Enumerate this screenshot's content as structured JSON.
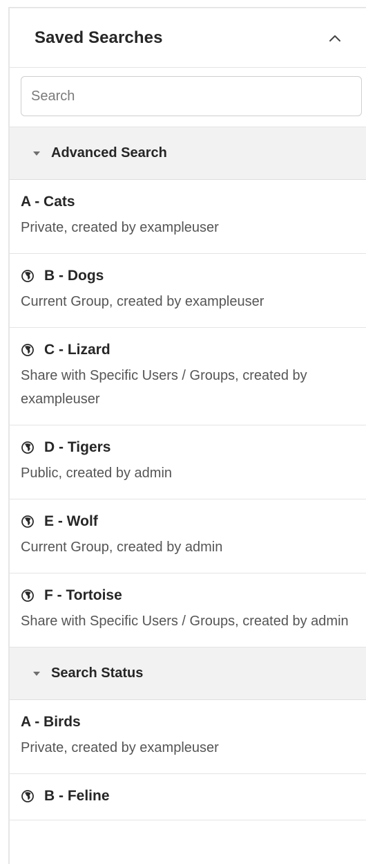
{
  "panel": {
    "title": "Saved Searches",
    "collapse_icon": "chevron-up-icon"
  },
  "search": {
    "placeholder": "Search",
    "value": ""
  },
  "groups": [
    {
      "label": "Advanced Search",
      "items": [
        {
          "title": "A - Cats",
          "shared": false,
          "description": "Private, created by exampleuser"
        },
        {
          "title": "B - Dogs",
          "shared": true,
          "description": "Current Group, created by exampleuser"
        },
        {
          "title": "C - Lizard",
          "shared": true,
          "description": "Share with Specific Users / Groups, created by exampleuser"
        },
        {
          "title": "D - Tigers",
          "shared": true,
          "description": "Public, created by admin"
        },
        {
          "title": "E - Wolf",
          "shared": true,
          "description": "Current Group, created by admin"
        },
        {
          "title": "F - Tortoise",
          "shared": true,
          "description": "Share with Specific Users / Groups, created by admin"
        }
      ]
    },
    {
      "label": "Search Status",
      "items": [
        {
          "title": "A - Birds",
          "shared": false,
          "description": "Private, created by exampleuser"
        },
        {
          "title": "B - Feline",
          "shared": true,
          "description": ""
        }
      ]
    }
  ],
  "icons": {
    "shared": "globe-icon",
    "group_toggle": "caret-down-icon"
  },
  "colors": {
    "group_header_bg": "#f2f2f2",
    "border": "#e4e4e4",
    "title_text": "#262626",
    "secondary_text": "#555555"
  }
}
